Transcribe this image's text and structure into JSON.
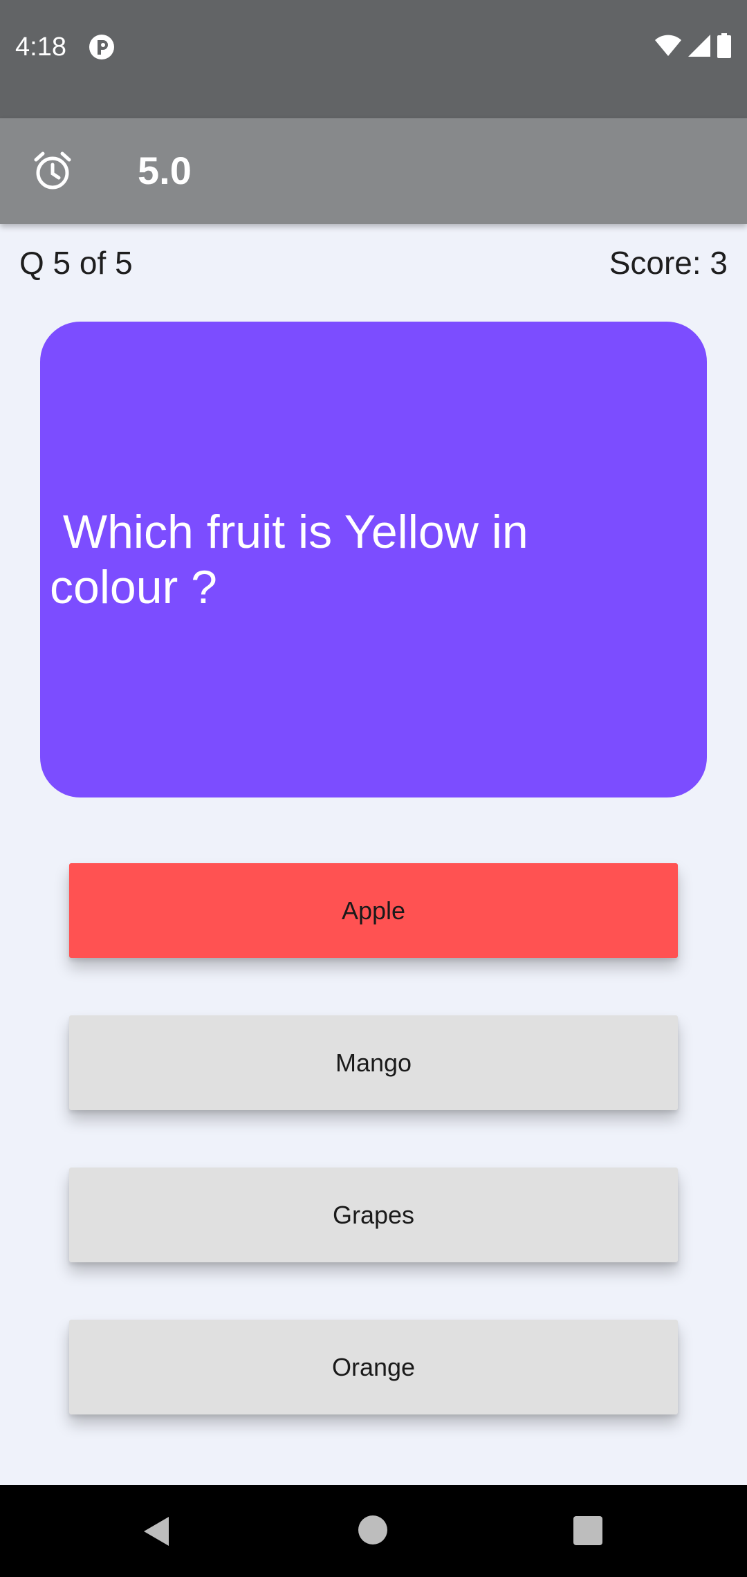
{
  "status_bar": {
    "time": "4:18",
    "icons": [
      "app-notification-icon",
      "wifi-icon",
      "cell-signal-icon",
      "battery-icon"
    ]
  },
  "app_bar": {
    "icon": "alarm-clock-icon",
    "timer": "5.0"
  },
  "quiz": {
    "progress": "Q 5 of 5",
    "score": "Score: 3",
    "question": " Which fruit is Yellow in\ncolour ?",
    "options": [
      {
        "label": "Apple",
        "state": "wrong"
      },
      {
        "label": "Mango",
        "state": "default"
      },
      {
        "label": "Grapes",
        "state": "default"
      },
      {
        "label": "Orange",
        "state": "default"
      }
    ]
  },
  "nav_bar": {
    "buttons": [
      "back-icon",
      "home-icon",
      "recents-icon"
    ]
  },
  "colors": {
    "status_bar": "#626466",
    "app_bar": "#87898b",
    "background": "#eff2fa",
    "question_card": "#7c4dff",
    "wrong_answer": "#ff5252",
    "option_default": "#e0e0e0"
  }
}
